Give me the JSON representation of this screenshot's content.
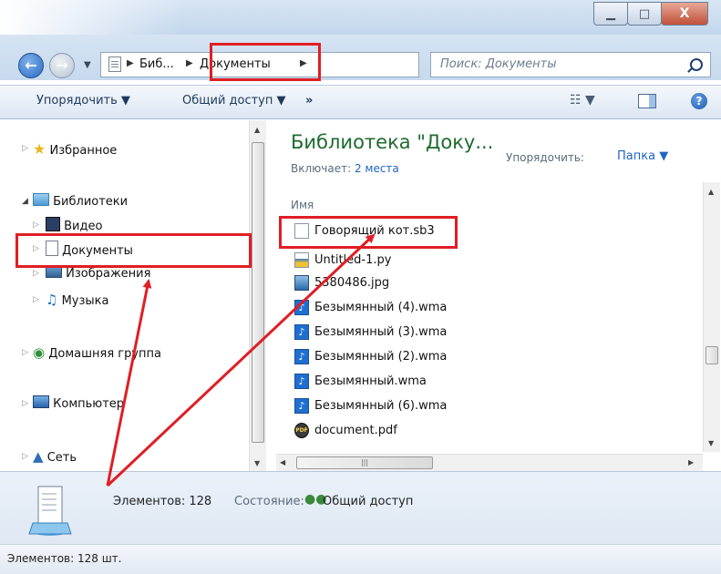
{
  "window": {
    "minimize_label": "▁",
    "maximize_label": "□",
    "close_label": "X"
  },
  "address": {
    "crumbs": [
      "Биб...",
      "Документы"
    ],
    "search_placeholder": "Поиск: Документы"
  },
  "toolbar": {
    "organize_label": "Упорядочить ▼",
    "share_label": "Общий доступ ▼",
    "more_label": "»"
  },
  "sidebar": {
    "favorites": "Избранное",
    "libraries": "Библиотеки",
    "video": "Видео",
    "documents": "Документы",
    "images": "Изображения",
    "music": "Музыка",
    "homegroup": "Домашняя группа",
    "computer": "Компьютер",
    "network": "Сеть"
  },
  "content": {
    "library_title": "Библиотека \"Доку...",
    "includes_label": "Включает: ",
    "includes_link": "2 места",
    "arrange_label": "Упорядочить:",
    "arrange_value": "Папка ▼",
    "column_name": "Имя",
    "files": [
      {
        "name": "Говорящий кот.sb3",
        "icon": "blank-file-icon"
      },
      {
        "name": "Untitled-1.py",
        "icon": "python-file-icon"
      },
      {
        "name": "5380486.jpg",
        "icon": "image-file-icon"
      },
      {
        "name": "Безымянный (4).wma",
        "icon": "audio-file-icon"
      },
      {
        "name": "Безымянный (3).wma",
        "icon": "audio-file-icon"
      },
      {
        "name": "Безымянный (2).wma",
        "icon": "audio-file-icon"
      },
      {
        "name": "Безымянный.wma",
        "icon": "audio-file-icon"
      },
      {
        "name": "Безымянный (6).wma",
        "icon": "audio-file-icon"
      },
      {
        "name": "document.pdf",
        "icon": "pdf-file-icon"
      }
    ]
  },
  "details": {
    "count": "Элементов: 128",
    "state_label": "Состояние:",
    "state_value": "Общий доступ"
  },
  "status": {
    "text": "Элементов: 128 шт."
  },
  "colors": {
    "highlight_red": "#e01e24",
    "library_title_green": "#1e6b2f",
    "link_blue": "#1f64c4"
  }
}
